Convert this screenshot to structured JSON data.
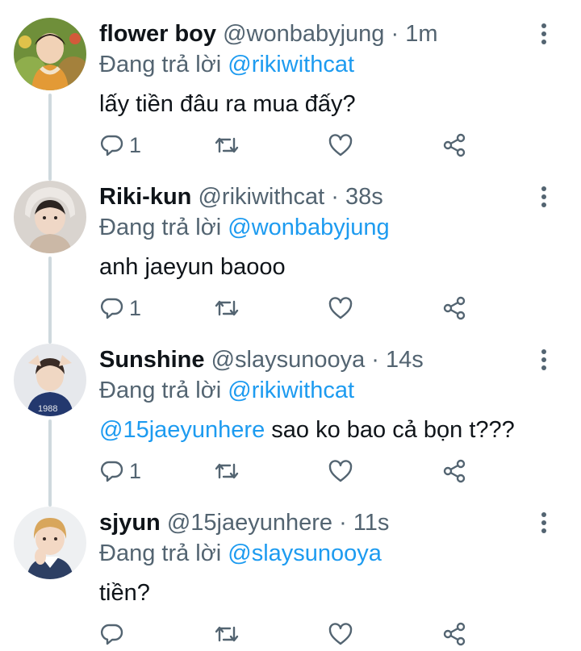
{
  "tweets": [
    {
      "name": "flower boy",
      "handle": "@wonbabyjung",
      "time": "· 1m",
      "reply_prefix": "Đang trả lời",
      "reply_to": "@rikiwithcat",
      "body_mention": "",
      "body_text": "lấy tiền đâu ra mua đấy?",
      "reply_count": "1"
    },
    {
      "name": "Riki-kun",
      "handle": "@rikiwithcat",
      "time": "· 38s",
      "reply_prefix": "Đang trả lời",
      "reply_to": "@wonbabyjung",
      "body_mention": "",
      "body_text": "anh jaeyun baooo",
      "reply_count": "1"
    },
    {
      "name": "Sunshine",
      "handle": "@slaysunooya",
      "time": "· 14s",
      "reply_prefix": "Đang trả lời",
      "reply_to": "@rikiwithcat",
      "body_mention": "@15jaeyunhere",
      "body_text": " sao ko bao cả bọn t???",
      "reply_count": "1"
    },
    {
      "name": "sjyun",
      "handle": "@15jaeyunhere",
      "time": "· 11s",
      "reply_prefix": "Đang trả lời",
      "reply_to": "@slaysunooya",
      "body_mention": "",
      "body_text": "tiền?",
      "reply_count": ""
    }
  ],
  "icons": {
    "reply": "reply-icon",
    "retweet": "retweet-icon",
    "like": "heart-icon",
    "share": "share-icon",
    "more": "more-options-icon"
  },
  "colors": {
    "text": "#0f1419",
    "muted": "#536471",
    "accent": "#1d9bf0",
    "thread_line": "#cfd9de"
  }
}
